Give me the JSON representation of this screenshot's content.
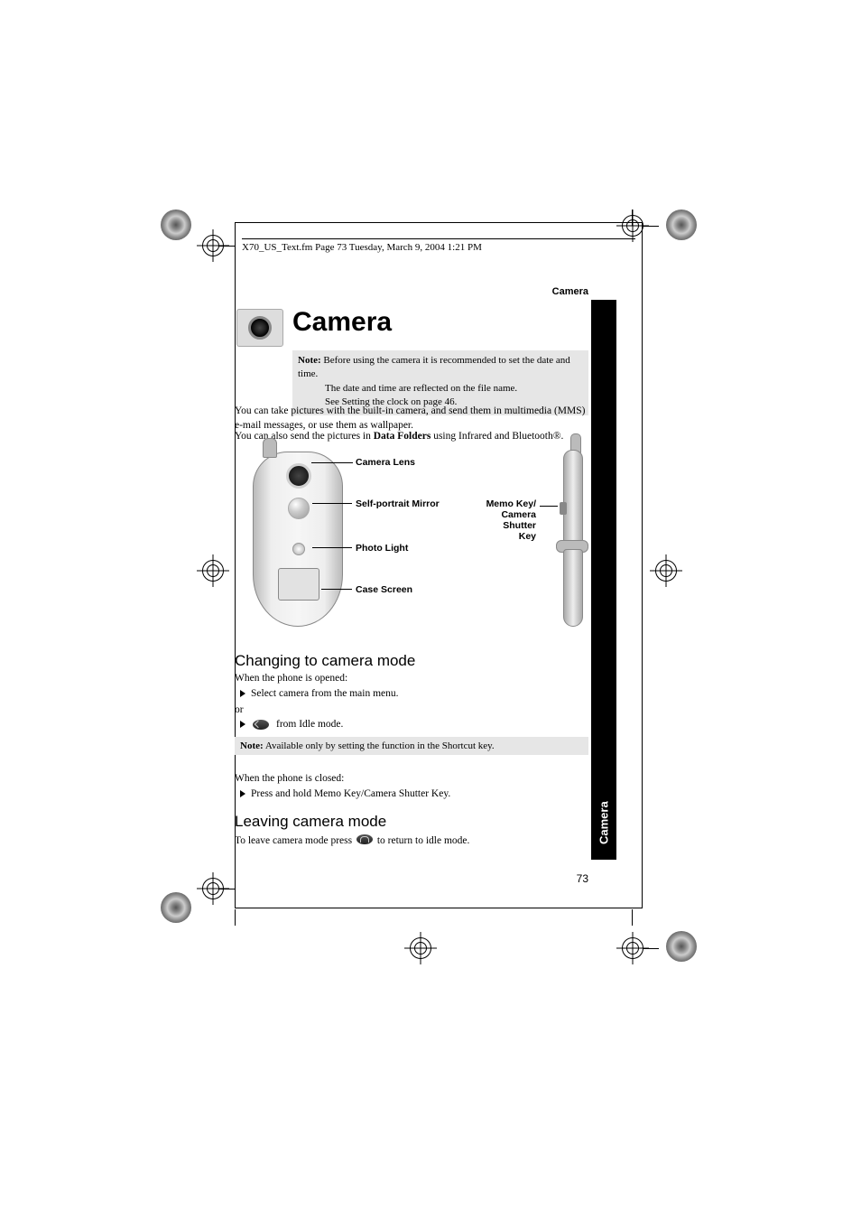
{
  "header_filename": "X70_US_Text.fm  Page 73  Tuesday, March 9, 2004  1:21 PM",
  "running_head": "Camera",
  "title": "Camera",
  "note1_lead": "Note:",
  "note1_line1": "Before using the camera it is recommended to set the date and time.",
  "note1_line2": "The date and time are reflected on the file name.",
  "note1_line3": "See Setting the clock on page 46.",
  "para1": "You can take pictures with the built-in camera, and send them in multimedia (MMS) e-mail messages, or use them as wallpaper.",
  "para2_pre": "You can also send the pictures in ",
  "para2_bold": "Data Folders",
  "para2_post": " using Infrared and Bluetooth®.",
  "callouts": {
    "lens": "Camera Lens",
    "mirror": "Self-portrait Mirror",
    "light": "Photo Light",
    "screen": "Case Screen",
    "memo1": "Memo Key/",
    "memo2": "Camera",
    "memo3": "Shutter Key"
  },
  "h_changing": "Changing to camera mode",
  "opened_label": "When the phone is opened:",
  "opened_bullet": "Select camera from the main menu.",
  "or_label": "or",
  "idle_bullet_post": " from Idle mode.",
  "note2_lead": "Note:",
  "note2_text": "Available only by setting the function in the Shortcut key.",
  "closed_label": "When the phone is closed:",
  "closed_bullet": "Press and hold Memo Key/Camera Shutter Key.",
  "h_leaving": "Leaving camera mode",
  "leaving_pre": "To leave camera mode press ",
  "leaving_post": " to return to idle mode.",
  "side_tab": "Camera",
  "page_num": "73"
}
